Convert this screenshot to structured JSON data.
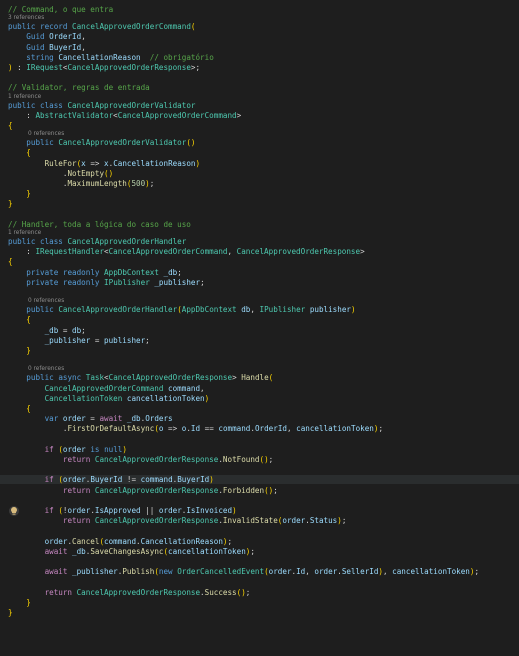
{
  "lines": [
    {
      "k": "c",
      "t": "// Command, o que entra"
    },
    {
      "k": "lens",
      "t": "3 references"
    },
    {
      "k": "x",
      "t": "public record CancelApprovedOrderCommand("
    },
    {
      "k": "x",
      "t": "    Guid OrderId,"
    },
    {
      "k": "x",
      "t": "    Guid BuyerId,"
    },
    {
      "k": "x",
      "t": "    string CancellationReason  // obrigatório"
    },
    {
      "k": "x",
      "t": ") : IRequest<CancelApprovedOrderResponse>;"
    },
    {
      "k": "b",
      "t": ""
    },
    {
      "k": "c",
      "t": "// Validator, regras de entrada"
    },
    {
      "k": "lens",
      "t": "1 reference"
    },
    {
      "k": "x",
      "t": "public class CancelApprovedOrderValidator"
    },
    {
      "k": "x",
      "t": "    : AbstractValidator<CancelApprovedOrderCommand>"
    },
    {
      "k": "x",
      "t": "{"
    },
    {
      "k": "lens",
      "t": "0 references"
    },
    {
      "k": "x",
      "t": "    public CancelApprovedOrderValidator()"
    },
    {
      "k": "x",
      "t": "    {"
    },
    {
      "k": "x",
      "t": "        RuleFor(x => x.CancellationReason)"
    },
    {
      "k": "x",
      "t": "            .NotEmpty()"
    },
    {
      "k": "x",
      "t": "            .MaximumLength(500);"
    },
    {
      "k": "x",
      "t": "    }"
    },
    {
      "k": "x",
      "t": "}"
    },
    {
      "k": "b",
      "t": ""
    },
    {
      "k": "c",
      "t": "// Handler, toda a lógica do caso de uso"
    },
    {
      "k": "lens",
      "t": "1 reference"
    },
    {
      "k": "x",
      "t": "public class CancelApprovedOrderHandler"
    },
    {
      "k": "x",
      "t": "    : IRequestHandler<CancelApprovedOrderCommand, CancelApprovedOrderResponse>"
    },
    {
      "k": "x",
      "t": "{"
    },
    {
      "k": "x",
      "t": "    private readonly AppDbContext _db;"
    },
    {
      "k": "x",
      "t": "    private readonly IPublisher _publisher;"
    },
    {
      "k": "b",
      "t": ""
    },
    {
      "k": "lens",
      "t": "0 references"
    },
    {
      "k": "x",
      "t": "    public CancelApprovedOrderHandler(AppDbContext db, IPublisher publisher)"
    },
    {
      "k": "x",
      "t": "    {"
    },
    {
      "k": "x",
      "t": "        _db = db;"
    },
    {
      "k": "x",
      "t": "        _publisher = publisher;"
    },
    {
      "k": "x",
      "t": "    }"
    },
    {
      "k": "b",
      "t": ""
    },
    {
      "k": "lens",
      "t": "0 references"
    },
    {
      "k": "x",
      "t": "    public async Task<CancelApprovedOrderResponse> Handle("
    },
    {
      "k": "x",
      "t": "        CancelApprovedOrderCommand command,"
    },
    {
      "k": "x",
      "t": "        CancellationToken cancellationToken)"
    },
    {
      "k": "x",
      "t": "    {"
    },
    {
      "k": "x",
      "t": "        var order = await _db.Orders"
    },
    {
      "k": "x",
      "t": "            .FirstOrDefaultAsync(o => o.Id == command.OrderId, cancellationToken);"
    },
    {
      "k": "b",
      "t": ""
    },
    {
      "k": "x",
      "t": "        if (order is null)"
    },
    {
      "k": "x",
      "t": "            return CancelApprovedOrderResponse.NotFound();"
    },
    {
      "k": "b",
      "t": ""
    },
    {
      "k": "x",
      "t": "        if (order.BuyerId != command.BuyerId)",
      "hl": true
    },
    {
      "k": "x",
      "t": "            return CancelApprovedOrderResponse.Forbidden();"
    },
    {
      "k": "b",
      "t": ""
    },
    {
      "k": "x",
      "t": "        if (!order.IsApproved || order.IsInvoiced)"
    },
    {
      "k": "x",
      "t": "            return CancelApprovedOrderResponse.InvalidState(order.Status);"
    },
    {
      "k": "b",
      "t": ""
    },
    {
      "k": "x",
      "t": "        order.Cancel(command.CancellationReason);"
    },
    {
      "k": "x",
      "t": "        await _db.SaveChangesAsync(cancellationToken);"
    },
    {
      "k": "b",
      "t": ""
    },
    {
      "k": "x",
      "t": "        await _publisher.Publish(new OrderCancelledEvent(order.Id, order.SellerId), cancellationToken);"
    },
    {
      "k": "b",
      "t": ""
    },
    {
      "k": "x",
      "t": "        return CancelApprovedOrderResponse.Success();"
    },
    {
      "k": "x",
      "t": "    }"
    },
    {
      "k": "x",
      "t": "}"
    }
  ],
  "colors": {
    "background": "#1e1e1e",
    "comment": "#57a64a",
    "keyword": "#569cd6",
    "type": "#4ec9b0",
    "method": "#dcdcaa",
    "param": "#9cdcfe"
  }
}
